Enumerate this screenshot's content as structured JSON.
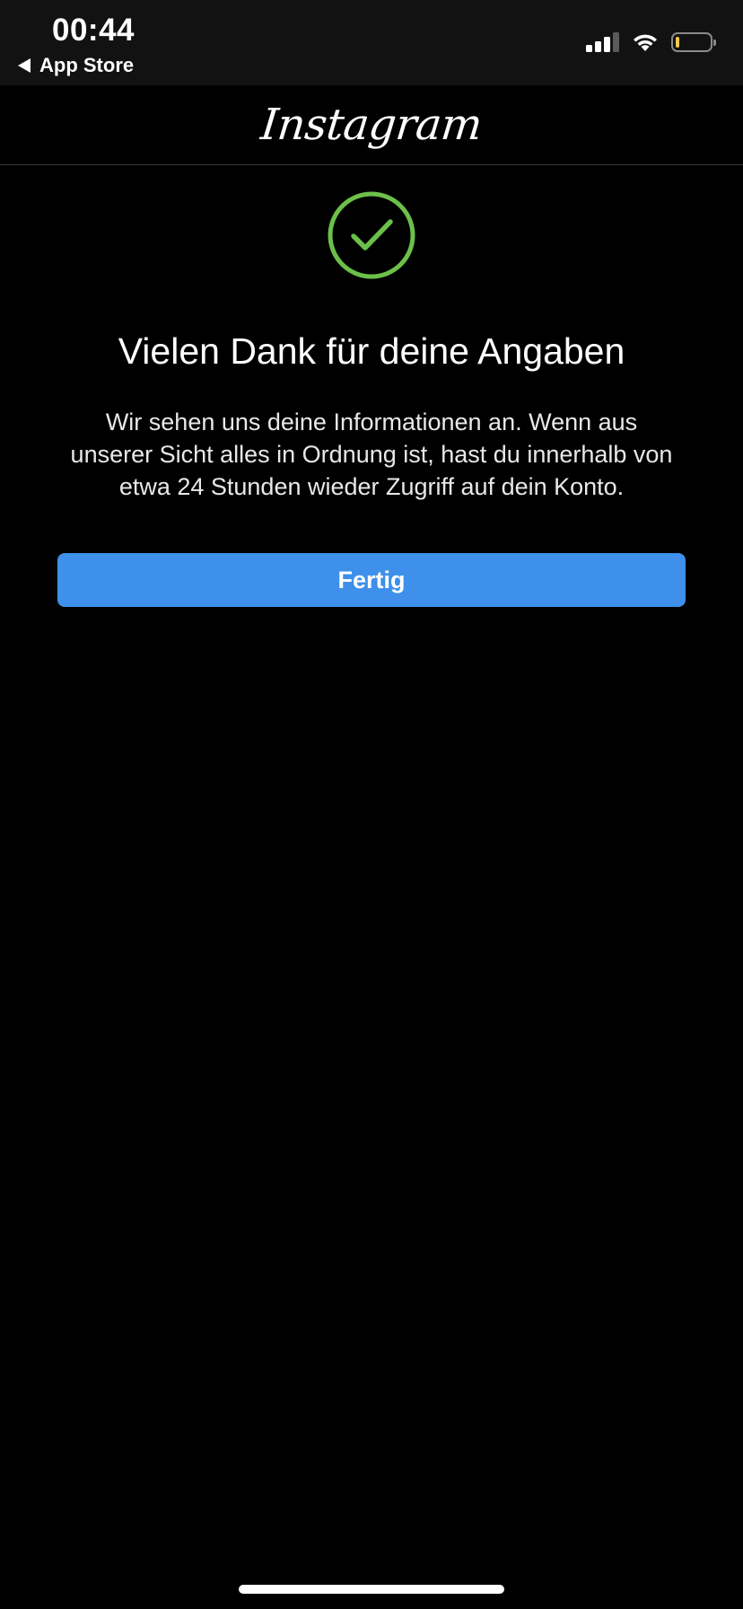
{
  "status_bar": {
    "time": "00:44",
    "back_label": "App Store",
    "battery_level": 0.12,
    "signal_bars_active": 3,
    "signal_bars_total": 4,
    "battery_color": "#f2c94c"
  },
  "header": {
    "logo_text": "Instagram"
  },
  "confirmation": {
    "icon": "check-circle-icon",
    "icon_color": "#6cc04a",
    "title": "Vielen Dank für deine Angaben",
    "message": "Wir sehen uns deine Informationen an. Wenn aus unserer Sicht alles in Ordnung ist, hast du innerhalb von etwa 24 Stunden wieder Zugriff auf dein Konto.",
    "done_button_label": "Fertig",
    "button_color": "#3e90ea"
  }
}
